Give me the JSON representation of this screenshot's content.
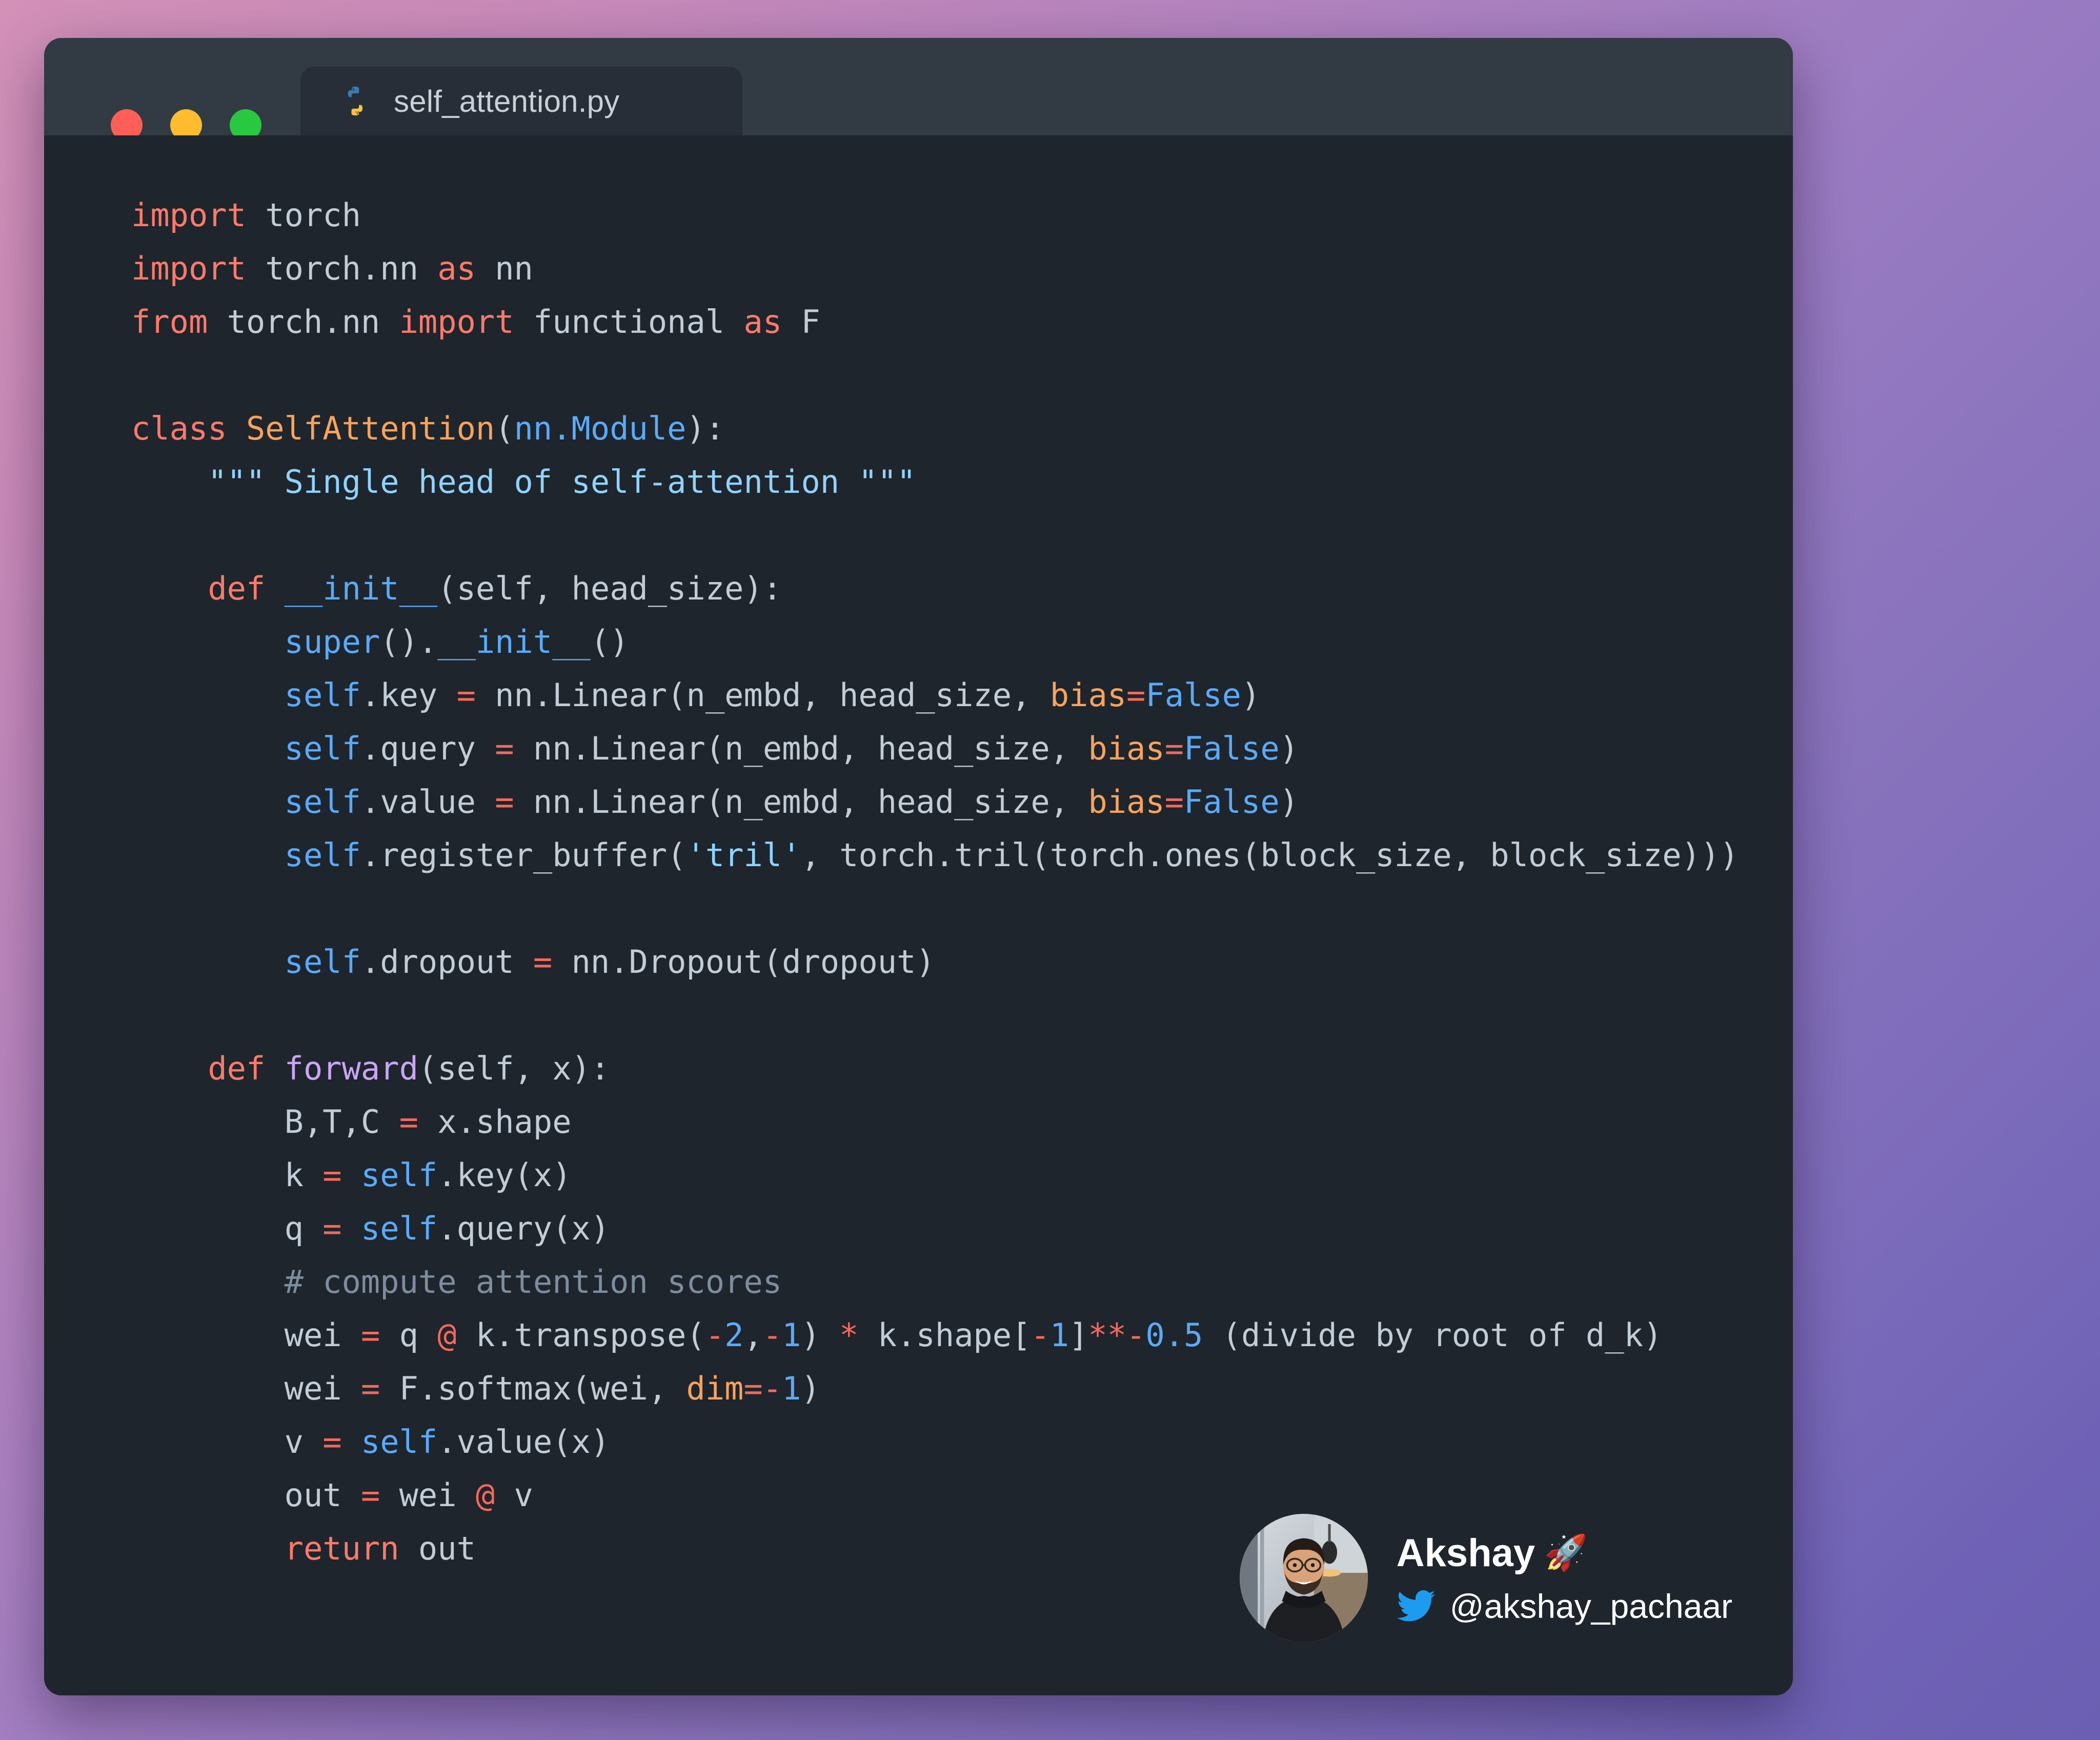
{
  "window": {
    "traffic_lights": [
      {
        "name": "close",
        "color": "#ff5f57"
      },
      {
        "name": "minimize",
        "color": "#febc2e"
      },
      {
        "name": "maximize",
        "color": "#28c840"
      }
    ],
    "tab": {
      "label": "self_attention.py",
      "icon": "python-icon"
    }
  },
  "editor": {
    "language": "python",
    "theme_background": "#1f252c",
    "colors": {
      "keyword": "#ff7a6b",
      "operator": "#f4695c",
      "class_name": "#f7a35c",
      "builtin_self": "#5aaafa",
      "string": "#8fd3ff",
      "function_name": "#c9a6f5",
      "comment": "#7d8da0",
      "plain": "#c2ccd6"
    },
    "code_lines": [
      "import torch",
      "import torch.nn as nn",
      "from torch.nn import functional as F",
      "",
      "class SelfAttention(nn.Module):",
      "    \"\"\" Single head of self-attention \"\"\"",
      "",
      "    def __init__(self, head_size):",
      "        super().__init__()",
      "        self.key = nn.Linear(n_embd, head_size, bias=False)",
      "        self.query = nn.Linear(n_embd, head_size, bias=False)",
      "        self.value = nn.Linear(n_embd, head_size, bias=False)",
      "        self.register_buffer('tril', torch.tril(torch.ones(block_size, block_size)))",
      "",
      "        self.dropout = nn.Dropout(dropout)",
      "",
      "    def forward(self, x):",
      "        B,T,C = x.shape",
      "        k = self.key(x)",
      "        q = self.query(x)",
      "        # compute attention scores",
      "        wei = q @ k.transpose(-2,-1) * k.shape[-1]**-0.5 (divide by root of d_k)",
      "        wei = F.softmax(wei, dim=-1)",
      "        v = self.value(x)",
      "        out = wei @ v",
      "        return out"
    ]
  },
  "author": {
    "name": "Akshay",
    "name_emoji": "🚀",
    "handle": "@akshay_pachaar",
    "social_icon": "twitter-bird-icon",
    "avatar_icon": "avatar-photo"
  },
  "background": {
    "gradient_from": "#d391b8",
    "gradient_to": "#6a5fb2"
  }
}
